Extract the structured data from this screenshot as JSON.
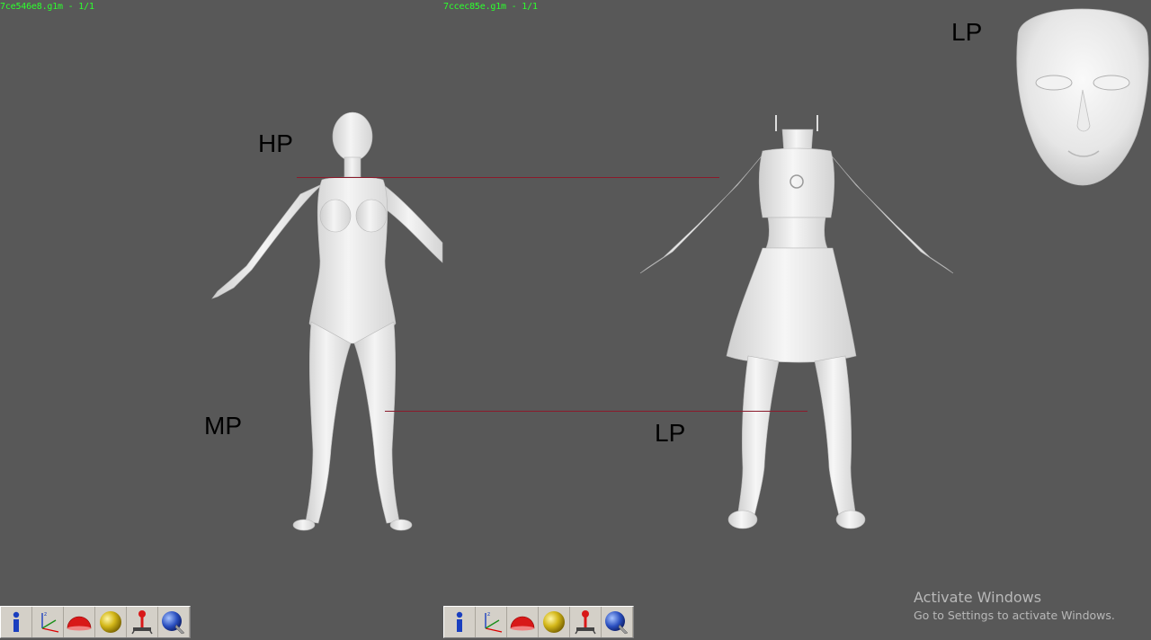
{
  "viewports": {
    "left": {
      "label": "7ce546e8.g1m - 1/1"
    },
    "right": {
      "label": "7ccec85e.g1m - 1/1"
    }
  },
  "annotations": {
    "hp": "HP",
    "mp": "MP",
    "lp_bottom": "LP",
    "lp_top": "LP"
  },
  "toolbar": {
    "buttons": [
      {
        "icon": "info-icon",
        "title": "Info"
      },
      {
        "icon": "axes-icon",
        "title": "Axes"
      },
      {
        "icon": "hemisphere-icon",
        "title": "Hemisphere"
      },
      {
        "icon": "sphere-icon",
        "title": "Sphere"
      },
      {
        "icon": "joystick-icon",
        "title": "Joystick"
      },
      {
        "icon": "rotate-globe-icon",
        "title": "Rotate"
      }
    ]
  },
  "watermark": {
    "title": "Activate Windows",
    "subtitle": "Go to Settings to activate Windows."
  },
  "colors": {
    "background": "#585858",
    "label_green": "#2dff2d",
    "guide_line": "#8b1a2b",
    "model_white": "#f0f0f0"
  }
}
